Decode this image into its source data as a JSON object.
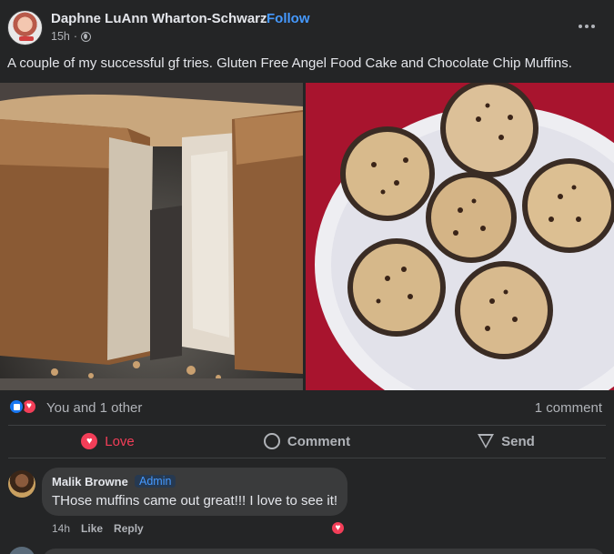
{
  "post": {
    "author": "Daphne LuAnn Wharton-Schwarz",
    "separator": "·",
    "follow_label": "Follow",
    "time": "15h",
    "more_icon": "more-horizontal-icon",
    "caption": "A couple of my successful gf tries. Gluten Free Angel Food Cake and Chocolate Chip Muffins."
  },
  "reactions": {
    "summary": "You and 1 other",
    "comments_count": "1 comment",
    "icons": [
      "like-icon",
      "love-icon"
    ]
  },
  "actions": {
    "love": "Love",
    "comment": "Comment",
    "send": "Send"
  },
  "comment": {
    "author": "Malik Browne",
    "badge": "Admin",
    "text": "THose muffins came out great!!! I love to see it!",
    "time": "14h",
    "like": "Like",
    "reply": "Reply",
    "reaction_icon": "love-icon"
  },
  "colors": {
    "background": "#242526",
    "follow": "#4599ff",
    "love": "#f33e58",
    "like": "#1877f2"
  }
}
